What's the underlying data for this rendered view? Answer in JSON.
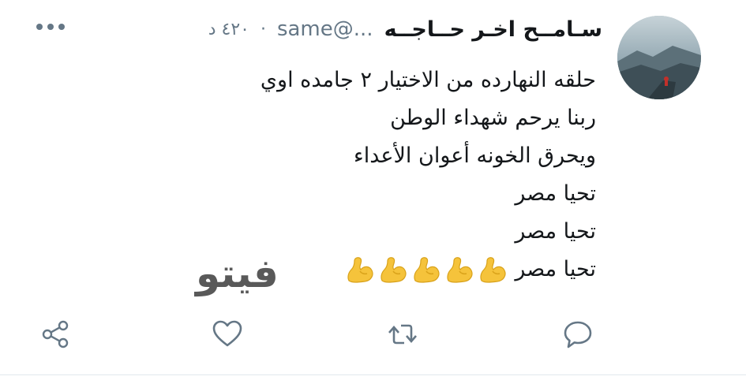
{
  "tweet": {
    "author_name": "سـامــح اخـر حــاجــه",
    "handle": "...@same",
    "time": "٤٢٠ د",
    "separator": "·",
    "lines": [
      "حلقه النهارده من الاختيار ٢ جامده اوي",
      "ربنا يرحم شهداء الوطن",
      "ويحرق الخونه أعوان الأعداء",
      "تحيا مصر",
      "تحيا مصر",
      "تحيا مصر"
    ],
    "emoji_name": "flexed-biceps",
    "emoji_count": 5
  },
  "watermark": {
    "text": "فيتو"
  },
  "actions": {
    "reply_icon": "reply-icon",
    "retweet_icon": "retweet-icon",
    "like_icon": "heart-icon",
    "share_icon": "share-icon"
  },
  "colors": {
    "text": "#14171a",
    "secondary": "#657786",
    "icon": "#657786",
    "emoji": "#f5c33b",
    "watermark_red": "#d9241f"
  }
}
